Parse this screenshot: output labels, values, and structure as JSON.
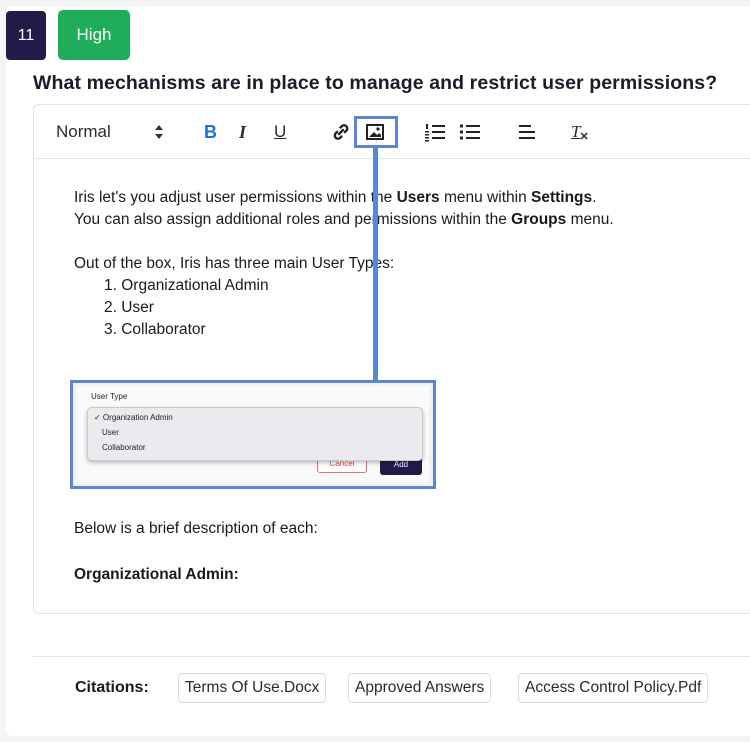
{
  "question": {
    "number": "11",
    "priority": "High",
    "text": "What mechanisms are in place to manage and restrict user permissions?"
  },
  "toolbar": {
    "format_select": "Normal",
    "bold_label": "B",
    "italic_label": "I",
    "underline_label": "U",
    "clear_format_label": "T"
  },
  "answer": {
    "line1_a": "Iris let's you adjust user permissions within the ",
    "line1_b": "Users",
    "line1_c": " menu within ",
    "line1_d": "Settings",
    "line1_e": ".",
    "line2_a": "You can also assign additional roles and permissions within the ",
    "line2_b": "Groups",
    "line2_c": " menu.",
    "intro": "Out of the box, Iris has three main User Types:",
    "user_types": [
      "1. Organizational Admin",
      "2. User",
      "3. Collaborator"
    ],
    "embedded_image": {
      "label": "User Type",
      "options": [
        "✓ Organization Admin",
        "User",
        "Collaborator"
      ],
      "cancel": "Cancel",
      "add": "Add"
    },
    "description_intro": "Below is a brief description of each:",
    "section_heading": "Organizational Admin:"
  },
  "citations": {
    "label": "Citations:",
    "items": [
      "Terms Of Use.Docx",
      "Approved Answers",
      "Access Control Policy.Pdf"
    ]
  },
  "colors": {
    "number_badge": "#231a4a",
    "priority_badge": "#1fad5a",
    "highlight": "#5b86d6",
    "bold_active": "#1f6fe0"
  }
}
